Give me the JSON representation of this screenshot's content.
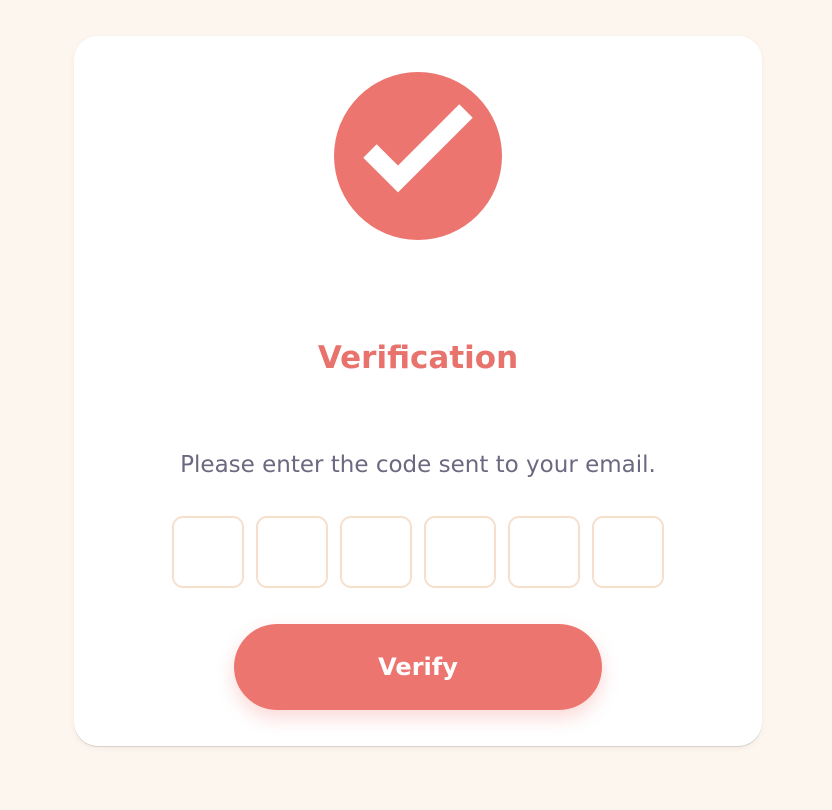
{
  "colors": {
    "page_background": "#fdf6ef",
    "card_background": "#ffffff",
    "accent": "#ed7570",
    "instruction_text": "#6b6980",
    "code_box_border": "#f6dfcb"
  },
  "badge": {
    "icon": "check-icon"
  },
  "title": "Verification",
  "instruction": "Please enter the code sent to your email.",
  "code_inputs": [
    {
      "value": ""
    },
    {
      "value": ""
    },
    {
      "value": ""
    },
    {
      "value": ""
    },
    {
      "value": ""
    },
    {
      "value": ""
    }
  ],
  "verify_button": {
    "label": "Verify"
  }
}
